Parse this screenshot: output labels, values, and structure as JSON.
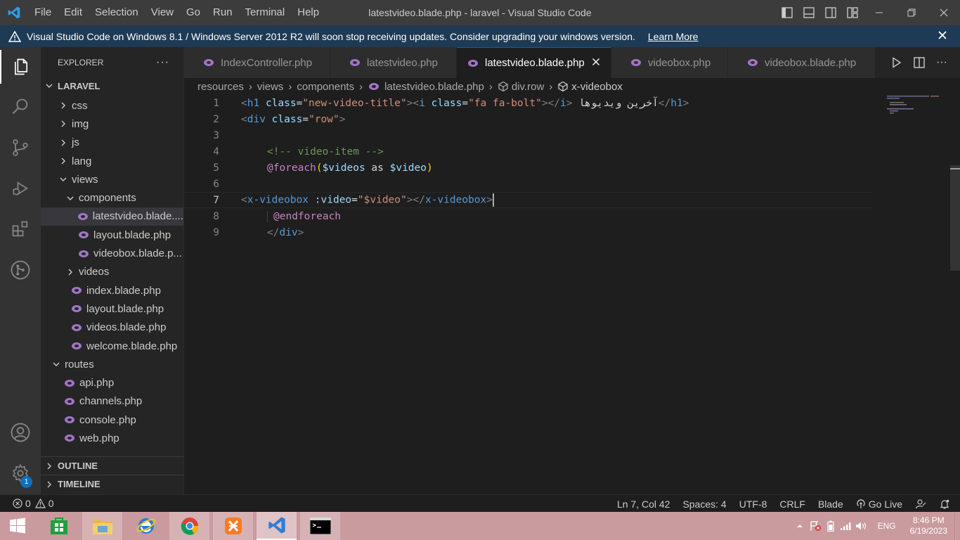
{
  "titlebar": {
    "menu": [
      "File",
      "Edit",
      "Selection",
      "View",
      "Go",
      "Run",
      "Terminal",
      "Help"
    ],
    "title": "latestvideo.blade.php - laravel - Visual Studio Code"
  },
  "banner": {
    "message": "Visual Studio Code on Windows 8.1 / Windows Server 2012 R2 will soon stop receiving updates. Consider upgrading your windows version.",
    "link": "Learn More"
  },
  "sidebar": {
    "header": "EXPLORER",
    "project": "LARAVEL",
    "tree": [
      {
        "label": "css",
        "type": "folder",
        "state": "collapsed",
        "indent": 1
      },
      {
        "label": "img",
        "type": "folder",
        "state": "collapsed",
        "indent": 1
      },
      {
        "label": "js",
        "type": "folder",
        "state": "collapsed",
        "indent": 1
      },
      {
        "label": "lang",
        "type": "folder",
        "state": "collapsed",
        "indent": 1
      },
      {
        "label": "views",
        "type": "folder",
        "state": "expanded",
        "indent": 1
      },
      {
        "label": "components",
        "type": "folder",
        "state": "expanded",
        "indent": 2
      },
      {
        "label": "latestvideo.blade....",
        "type": "file",
        "indent": 3,
        "selected": true
      },
      {
        "label": "layout.blade.php",
        "type": "file",
        "indent": 3
      },
      {
        "label": "videobox.blade.p...",
        "type": "file",
        "indent": 3
      },
      {
        "label": "videos",
        "type": "folder",
        "state": "collapsed",
        "indent": 2
      },
      {
        "label": "index.blade.php",
        "type": "file",
        "indent": 2
      },
      {
        "label": "layout.blade.php",
        "type": "file",
        "indent": 2
      },
      {
        "label": "videos.blade.php",
        "type": "file",
        "indent": 2
      },
      {
        "label": "welcome.blade.php",
        "type": "file",
        "indent": 2
      },
      {
        "label": "routes",
        "type": "folder",
        "state": "expanded",
        "indent": 0
      },
      {
        "label": "api.php",
        "type": "file",
        "indent": 1
      },
      {
        "label": "channels.php",
        "type": "file",
        "indent": 1
      },
      {
        "label": "console.php",
        "type": "file",
        "indent": 1
      },
      {
        "label": "web.php",
        "type": "file",
        "indent": 1
      }
    ],
    "outline": "OUTLINE",
    "timeline": "TIMELINE"
  },
  "tabs": [
    {
      "label": "IndexController.php",
      "active": false
    },
    {
      "label": "latestvideo.php",
      "active": false
    },
    {
      "label": "latestvideo.blade.php",
      "active": true
    },
    {
      "label": "videobox.php",
      "active": false
    },
    {
      "label": "videobox.blade.php",
      "active": false
    }
  ],
  "breadcrumb": [
    "resources",
    "views",
    "components",
    "latestvideo.blade.php",
    "div.row",
    "x-videobox"
  ],
  "editor": {
    "line_numbers": [
      "1",
      "2",
      "3",
      "4",
      "5",
      "6",
      "7",
      "8",
      "9"
    ],
    "current_line": 7,
    "tokens": {
      "l1_h1": "h1",
      "l1_class_attr": "class",
      "l1_class_val": "\"new-video-title\"",
      "l1_i": "i",
      "l1_i_class_val": "\"fa fa-bolt\"",
      "l1_text": "آخرین ویدیوها",
      "l2_div": "div",
      "l2_class_attr": "class",
      "l2_class_val": "\"row\"",
      "l4_comment": "<!-- video-item -->",
      "l5_foreach": "@foreach",
      "l5_var1": "$videos",
      "l5_as": " as ",
      "l5_var2": "$video",
      "l7_tag": "x-videobox",
      "l7_attr": ":video",
      "l7_val": "\"$video\"",
      "l8_endforeach": "@endforeach",
      "l9_div": "div"
    }
  },
  "statusbar": {
    "errors": "0",
    "warnings": "0",
    "position": "Ln 7, Col 42",
    "spaces": "Spaces: 4",
    "encoding": "UTF-8",
    "eol": "CRLF",
    "language": "Blade",
    "golive": "Go Live"
  },
  "activity": {
    "settings_badge": "1"
  },
  "taskbar": {
    "language": "ENG",
    "time": "8:46 PM",
    "date": "6/19/2023"
  },
  "colors": {
    "accent": "#0e639c",
    "php_icon": "#a074c4",
    "banner": "#1e3a55",
    "taskbar": "#c99a9e"
  }
}
